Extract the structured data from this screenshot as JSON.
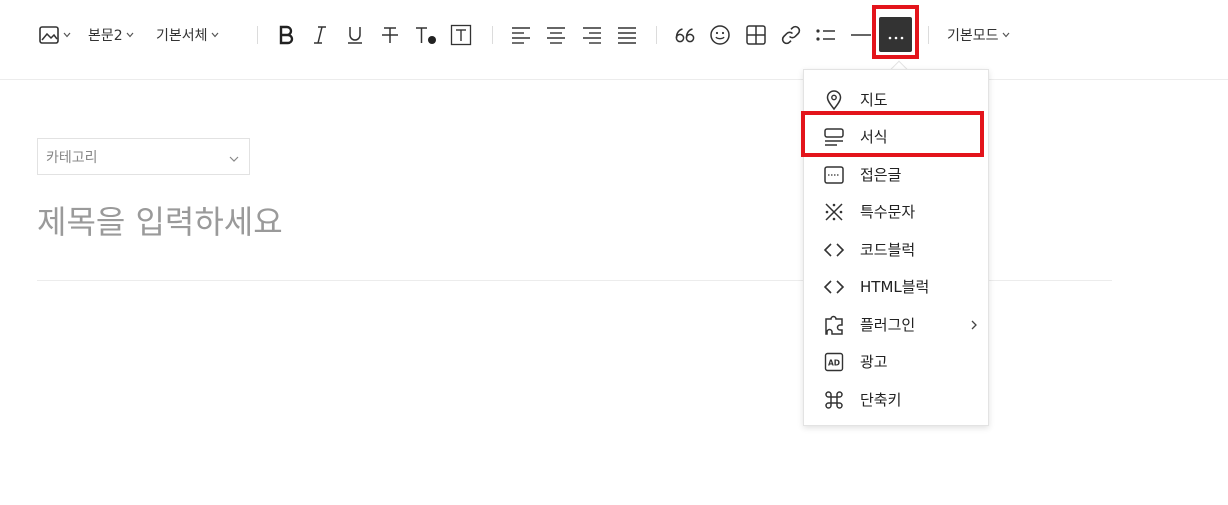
{
  "toolbar": {
    "paragraph_style": "본문2",
    "font_family": "기본서체",
    "mode": "기본모드",
    "more_label": "···"
  },
  "editor": {
    "category_label": "카테고리",
    "title_placeholder": "제목을 입력하세요"
  },
  "menu": {
    "items": [
      {
        "label": "지도",
        "icon": "map-pin-icon"
      },
      {
        "label": "서식",
        "icon": "template-icon"
      },
      {
        "label": "접은글",
        "icon": "fold-text-icon"
      },
      {
        "label": "특수문자",
        "icon": "special-char-icon"
      },
      {
        "label": "코드블럭",
        "icon": "code-icon"
      },
      {
        "label": "HTML블럭",
        "icon": "html-code-icon"
      },
      {
        "label": "플러그인",
        "icon": "plugin-icon"
      },
      {
        "label": "광고",
        "icon": "ad-icon"
      },
      {
        "label": "단축키",
        "icon": "command-key-icon"
      }
    ]
  },
  "colors": {
    "highlight": "#e3141b",
    "more_button_bg": "#333333"
  }
}
